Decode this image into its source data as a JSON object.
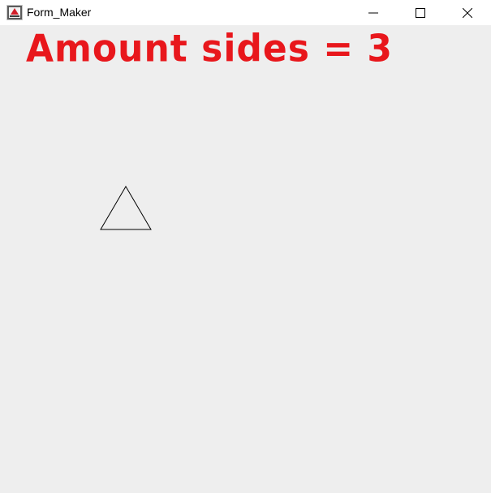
{
  "window": {
    "title": "Form_Maker",
    "icons": {
      "app": "java-app-icon",
      "minimize": "minimize-icon",
      "maximize": "maximize-icon",
      "close": "close-icon"
    }
  },
  "canvas": {
    "annotation": "Amount sides = 3",
    "annotation_color": "#e8171c",
    "shape": "triangle",
    "sides": 3,
    "shape_stroke": "#000000"
  }
}
